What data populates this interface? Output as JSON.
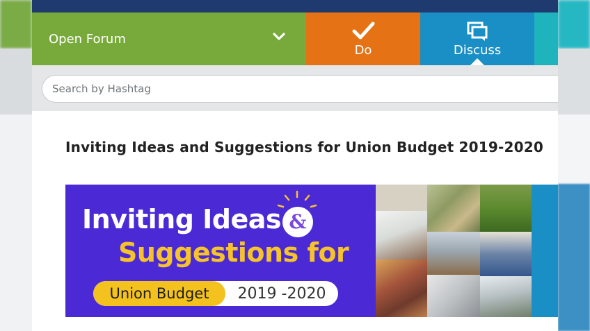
{
  "nav": {
    "forum_label": "Open Forum",
    "do_label": "Do",
    "discuss_label": "Discuss"
  },
  "search": {
    "placeholder": "Search by Hashtag"
  },
  "main": {
    "title": "Inviting Ideas and Suggestions for Union Budget 2019-2020"
  },
  "banner": {
    "line1": "Inviting Ideas",
    "amp": "&",
    "line2": "Suggestions for",
    "pill_left": "Union Budget",
    "pill_right": "2019 -2020"
  },
  "colors": {
    "forum_green": "#78a93b",
    "do_orange": "#e57316",
    "discuss_blue": "#1a8fc6",
    "topbar_navy": "#1f3a6e",
    "banner_purple": "#4b2ad6",
    "banner_yellow": "#f6c42a"
  },
  "icons": {
    "forum": "chevron-down-icon",
    "do": "checkmark-icon",
    "discuss": "chat-bubbles-icon"
  }
}
